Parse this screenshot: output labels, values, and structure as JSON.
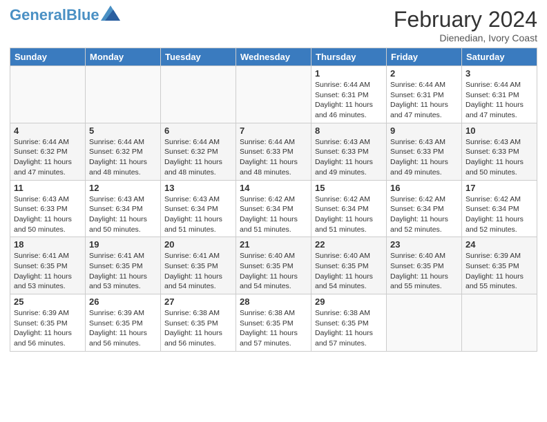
{
  "header": {
    "logo_general": "General",
    "logo_blue": "Blue",
    "month_title": "February 2024",
    "subtitle": "Dienedian, Ivory Coast"
  },
  "days_of_week": [
    "Sunday",
    "Monday",
    "Tuesday",
    "Wednesday",
    "Thursday",
    "Friday",
    "Saturday"
  ],
  "weeks": [
    [
      {
        "day": "",
        "empty": true
      },
      {
        "day": "",
        "empty": true
      },
      {
        "day": "",
        "empty": true
      },
      {
        "day": "",
        "empty": true
      },
      {
        "day": "1",
        "sunrise": "6:44 AM",
        "sunset": "6:31 PM",
        "daylight": "11 hours and 46 minutes."
      },
      {
        "day": "2",
        "sunrise": "6:44 AM",
        "sunset": "6:31 PM",
        "daylight": "11 hours and 47 minutes."
      },
      {
        "day": "3",
        "sunrise": "6:44 AM",
        "sunset": "6:31 PM",
        "daylight": "11 hours and 47 minutes."
      }
    ],
    [
      {
        "day": "4",
        "sunrise": "6:44 AM",
        "sunset": "6:32 PM",
        "daylight": "11 hours and 47 minutes."
      },
      {
        "day": "5",
        "sunrise": "6:44 AM",
        "sunset": "6:32 PM",
        "daylight": "11 hours and 48 minutes."
      },
      {
        "day": "6",
        "sunrise": "6:44 AM",
        "sunset": "6:32 PM",
        "daylight": "11 hours and 48 minutes."
      },
      {
        "day": "7",
        "sunrise": "6:44 AM",
        "sunset": "6:33 PM",
        "daylight": "11 hours and 48 minutes."
      },
      {
        "day": "8",
        "sunrise": "6:43 AM",
        "sunset": "6:33 PM",
        "daylight": "11 hours and 49 minutes."
      },
      {
        "day": "9",
        "sunrise": "6:43 AM",
        "sunset": "6:33 PM",
        "daylight": "11 hours and 49 minutes."
      },
      {
        "day": "10",
        "sunrise": "6:43 AM",
        "sunset": "6:33 PM",
        "daylight": "11 hours and 50 minutes."
      }
    ],
    [
      {
        "day": "11",
        "sunrise": "6:43 AM",
        "sunset": "6:33 PM",
        "daylight": "11 hours and 50 minutes."
      },
      {
        "day": "12",
        "sunrise": "6:43 AM",
        "sunset": "6:34 PM",
        "daylight": "11 hours and 50 minutes."
      },
      {
        "day": "13",
        "sunrise": "6:43 AM",
        "sunset": "6:34 PM",
        "daylight": "11 hours and 51 minutes."
      },
      {
        "day": "14",
        "sunrise": "6:42 AM",
        "sunset": "6:34 PM",
        "daylight": "11 hours and 51 minutes."
      },
      {
        "day": "15",
        "sunrise": "6:42 AM",
        "sunset": "6:34 PM",
        "daylight": "11 hours and 51 minutes."
      },
      {
        "day": "16",
        "sunrise": "6:42 AM",
        "sunset": "6:34 PM",
        "daylight": "11 hours and 52 minutes."
      },
      {
        "day": "17",
        "sunrise": "6:42 AM",
        "sunset": "6:34 PM",
        "daylight": "11 hours and 52 minutes."
      }
    ],
    [
      {
        "day": "18",
        "sunrise": "6:41 AM",
        "sunset": "6:35 PM",
        "daylight": "11 hours and 53 minutes."
      },
      {
        "day": "19",
        "sunrise": "6:41 AM",
        "sunset": "6:35 PM",
        "daylight": "11 hours and 53 minutes."
      },
      {
        "day": "20",
        "sunrise": "6:41 AM",
        "sunset": "6:35 PM",
        "daylight": "11 hours and 54 minutes."
      },
      {
        "day": "21",
        "sunrise": "6:40 AM",
        "sunset": "6:35 PM",
        "daylight": "11 hours and 54 minutes."
      },
      {
        "day": "22",
        "sunrise": "6:40 AM",
        "sunset": "6:35 PM",
        "daylight": "11 hours and 54 minutes."
      },
      {
        "day": "23",
        "sunrise": "6:40 AM",
        "sunset": "6:35 PM",
        "daylight": "11 hours and 55 minutes."
      },
      {
        "day": "24",
        "sunrise": "6:39 AM",
        "sunset": "6:35 PM",
        "daylight": "11 hours and 55 minutes."
      }
    ],
    [
      {
        "day": "25",
        "sunrise": "6:39 AM",
        "sunset": "6:35 PM",
        "daylight": "11 hours and 56 minutes."
      },
      {
        "day": "26",
        "sunrise": "6:39 AM",
        "sunset": "6:35 PM",
        "daylight": "11 hours and 56 minutes."
      },
      {
        "day": "27",
        "sunrise": "6:38 AM",
        "sunset": "6:35 PM",
        "daylight": "11 hours and 56 minutes."
      },
      {
        "day": "28",
        "sunrise": "6:38 AM",
        "sunset": "6:35 PM",
        "daylight": "11 hours and 57 minutes."
      },
      {
        "day": "29",
        "sunrise": "6:38 AM",
        "sunset": "6:35 PM",
        "daylight": "11 hours and 57 minutes."
      },
      {
        "day": "",
        "empty": true
      },
      {
        "day": "",
        "empty": true
      }
    ]
  ]
}
